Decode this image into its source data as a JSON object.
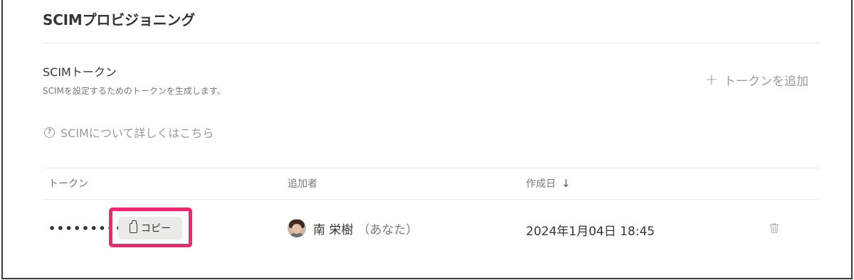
{
  "section": {
    "title": "SCIMプロビジョニング"
  },
  "token_section": {
    "heading": "SCIMトークン",
    "description": "SCIMを設定するためのトークンを生成します。",
    "add_button_label": "トークンを追加",
    "learn_more_label": "SCIMについて詳しくはこちら"
  },
  "table": {
    "headers": {
      "token": "トークン",
      "added_by": "追加者",
      "created_at": "作成日"
    },
    "sort_indicator": "↓",
    "rows": [
      {
        "token_masked": "•••••••••",
        "copy_label": "コピー",
        "added_by_name": "南 栄樹",
        "added_by_suffix": "（あなた）",
        "created_at": "2024年1月04日 18:45"
      }
    ]
  },
  "colors": {
    "highlight": "#f0266e",
    "muted_text": "#9b9a97",
    "primary_text": "#37352f"
  }
}
